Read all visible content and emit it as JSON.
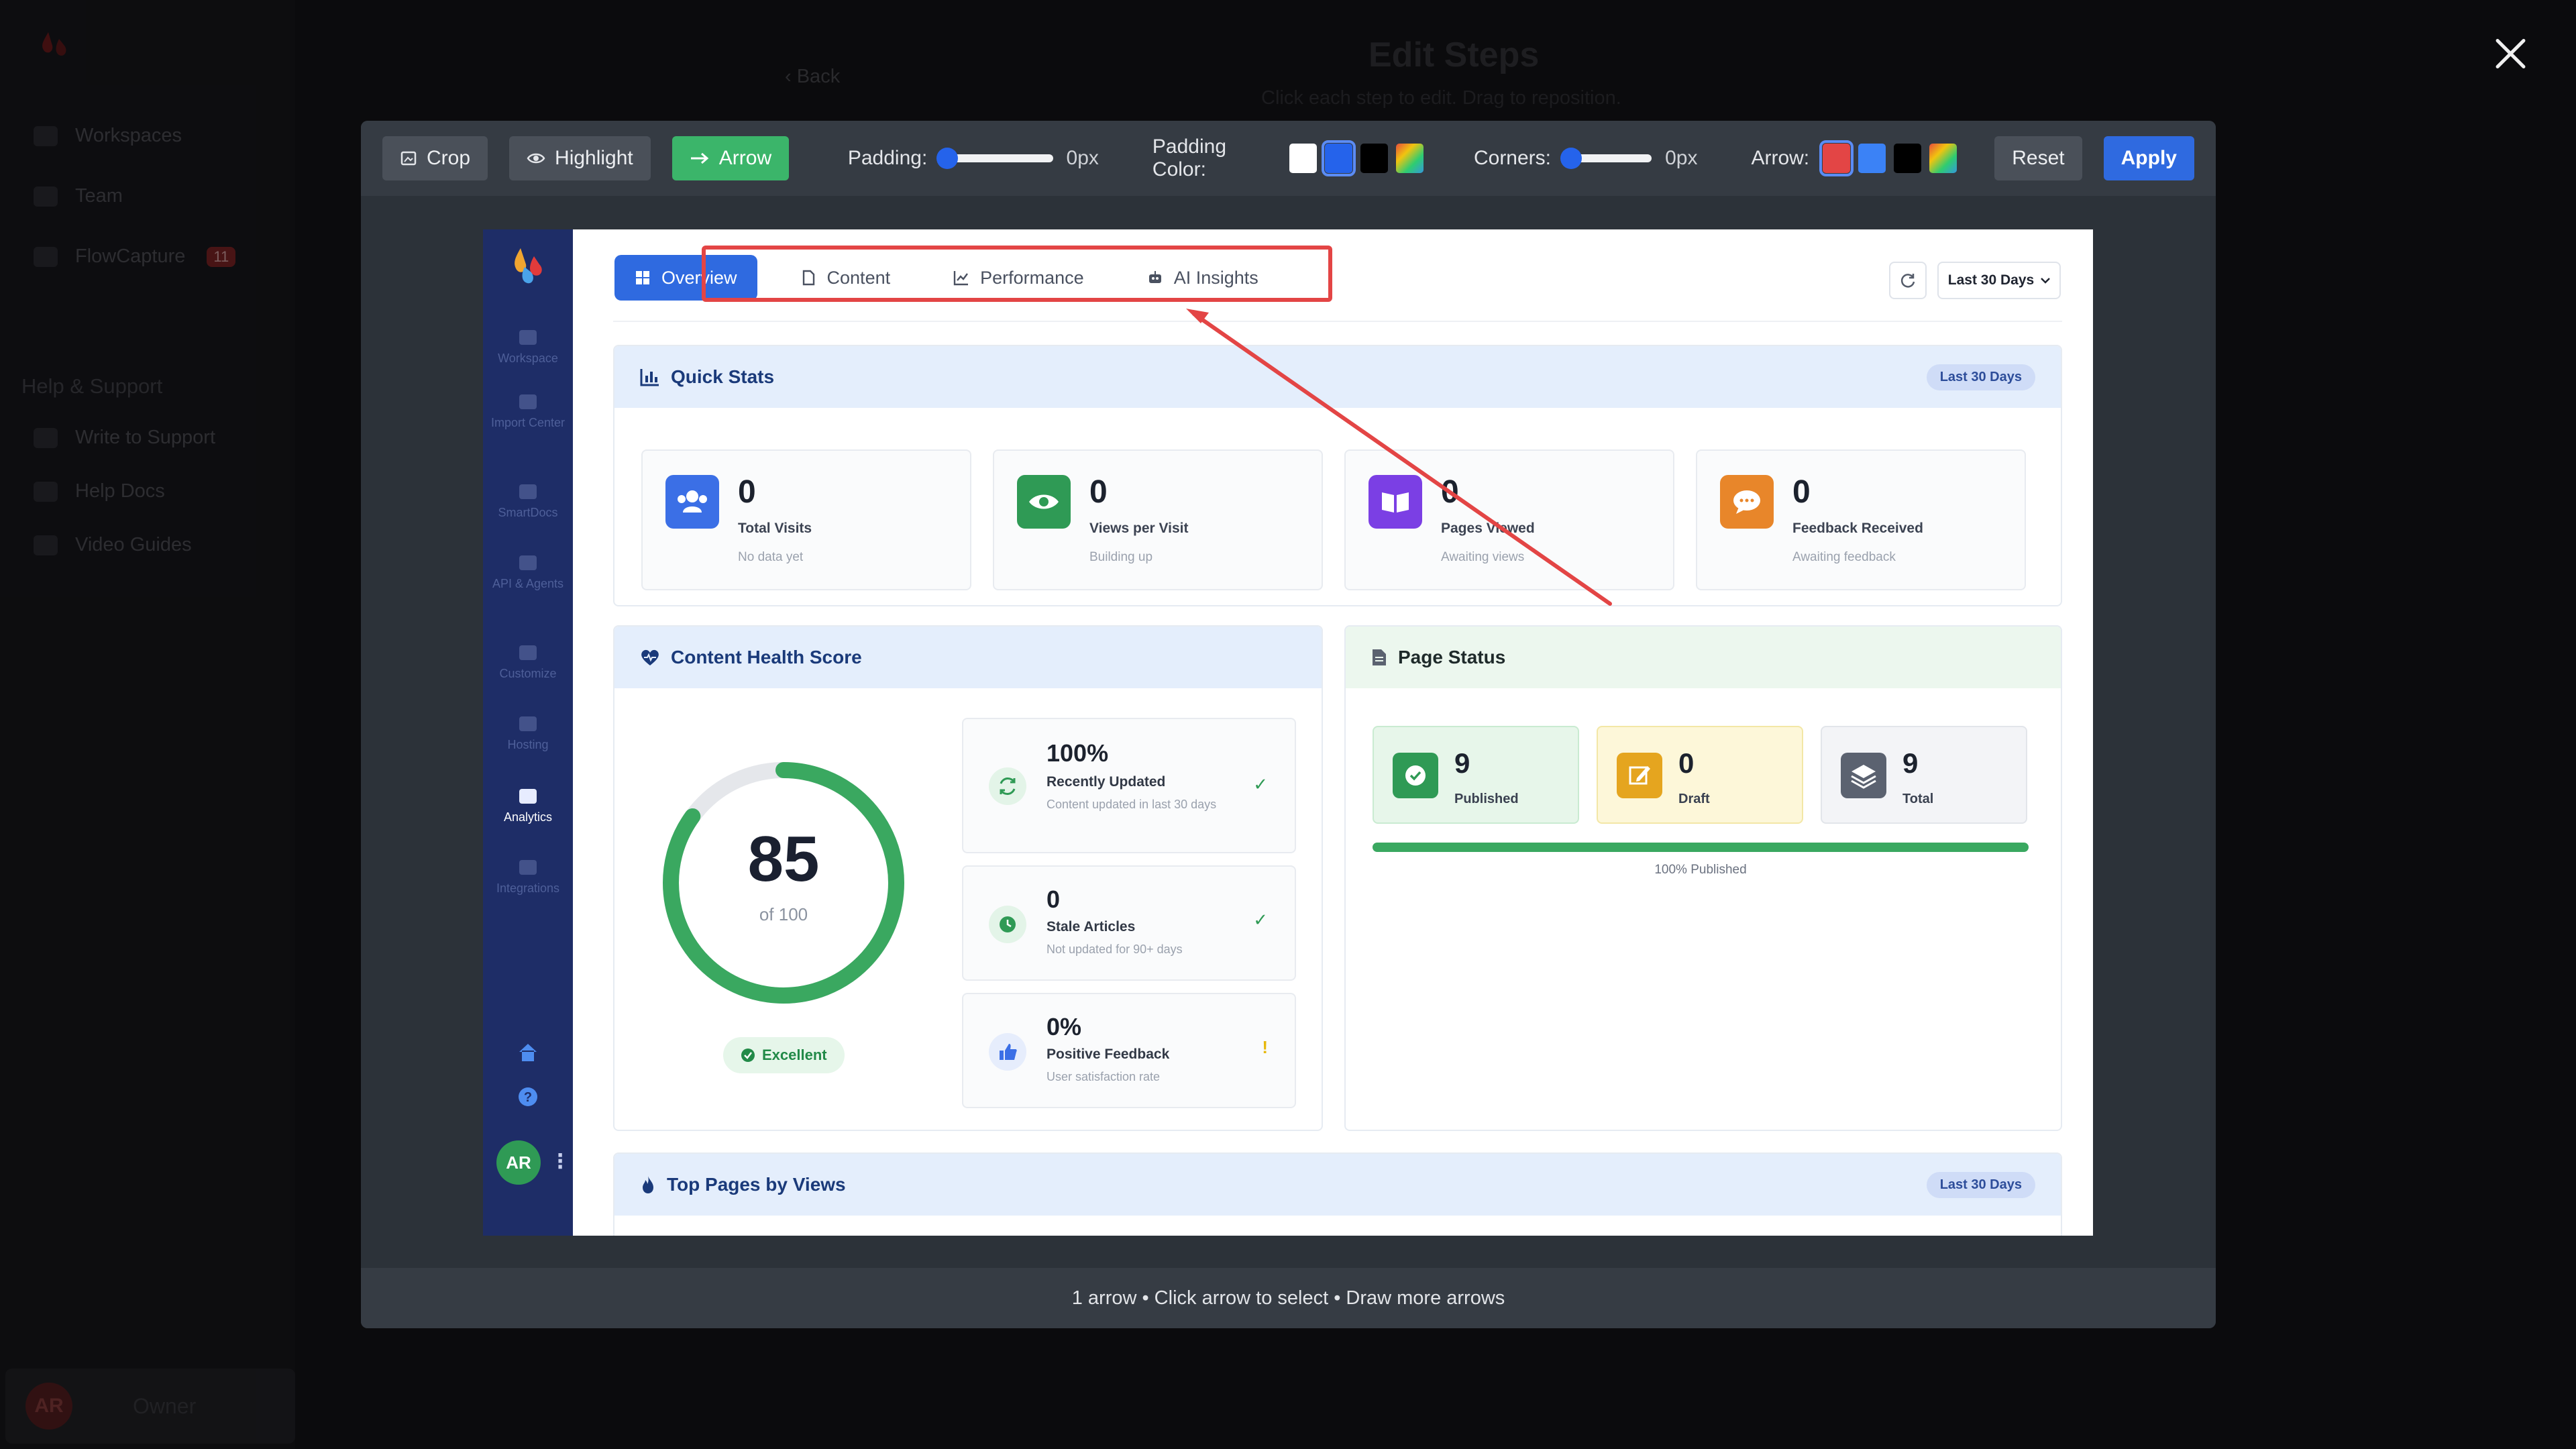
{
  "background": {
    "nav": [
      "Workspaces",
      "Team",
      "FlowCapture"
    ],
    "flow_badge": "11",
    "help_section": "Help & Support",
    "help_items": [
      "Write to Support",
      "Help Docs",
      "Video Guides"
    ],
    "user_initials": "AR",
    "user_role": "Owner",
    "page_title": "Edit Steps",
    "page_subtitle": "Click each step to edit. Drag to reposition.",
    "back_label": "Back"
  },
  "toolbar": {
    "crop": "Crop",
    "highlight": "Highlight",
    "arrow": "Arrow",
    "padding_label": "Padding:",
    "padding_value": "0px",
    "padding_color_label": "Padding Color:",
    "corners_label": "Corners:",
    "corners_value": "0px",
    "arrow_label": "Arrow:",
    "reset": "Reset",
    "apply": "Apply",
    "padding_swatches": [
      "#ffffff",
      "#2563eb",
      "#000000",
      "gradient"
    ],
    "arrow_swatches": [
      "#e34545",
      "#3b82f6",
      "#000000",
      "gradient"
    ]
  },
  "footer": {
    "status": "1 arrow • Click arrow to select • Draw more arrows"
  },
  "shot": {
    "sidebar": {
      "items": [
        "Workspace",
        "Import Center",
        "SmartDocs",
        "API & Agents",
        "Customize",
        "Hosting",
        "Analytics",
        "Integrations"
      ],
      "active": "Analytics",
      "avatar": "AR"
    },
    "tabs": [
      "Overview",
      "Content",
      "Performance",
      "AI Insights"
    ],
    "range": "Last 30 Days",
    "quick_stats": {
      "title": "Quick Stats",
      "pill": "Last 30 Days",
      "items": [
        {
          "value": "0",
          "label": "Total Visits",
          "sub": "No data yet",
          "color": "#3b6fe6"
        },
        {
          "value": "0",
          "label": "Views per Visit",
          "sub": "Building up",
          "color": "#2f9a55"
        },
        {
          "value": "0",
          "label": "Pages Viewed",
          "sub": "Awaiting views",
          "color": "#7b3fe4"
        },
        {
          "value": "0",
          "label": "Feedback Received",
          "sub": "Awaiting feedback",
          "color": "#e8862a"
        }
      ]
    },
    "health": {
      "title": "Content Health Score",
      "score": "85",
      "of": "of 100",
      "score_value": 85,
      "badge": "Excellent",
      "metrics": [
        {
          "value": "100%",
          "label": "Recently Updated",
          "sub": "Content updated in last 30 days",
          "mark": "✓"
        },
        {
          "value": "0",
          "label": "Stale Articles",
          "sub": "Not updated for 90+ days",
          "mark": "✓"
        },
        {
          "value": "0%",
          "label": "Positive Feedback",
          "sub": "User satisfaction rate",
          "mark": "!"
        }
      ]
    },
    "page_status": {
      "title": "Page Status",
      "items": [
        {
          "value": "9",
          "label": "Published"
        },
        {
          "value": "0",
          "label": "Draft"
        },
        {
          "value": "9",
          "label": "Total"
        }
      ],
      "published_pct": 100,
      "bar_label": "100% Published"
    },
    "top_pages": {
      "title": "Top Pages by Views",
      "pill": "Last 30 Days"
    }
  }
}
